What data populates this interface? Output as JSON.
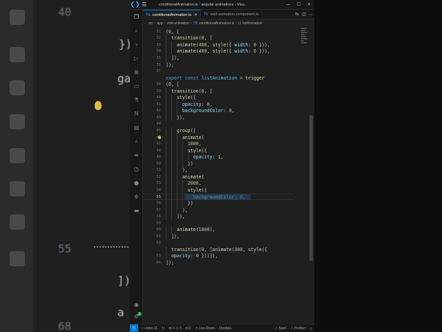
{
  "background": {
    "left_numbers": [
      "40",
      "55",
      "68"
    ],
    "left_code": [
      "});",
      "ga",
      "]),",
      "a"
    ]
  },
  "window": {
    "title": "conditionalAnimation.ts - angular-animations - Visu..."
  },
  "tabs": [
    {
      "label": "conditionalAnimation.ts",
      "active": true
    },
    {
      "label": "void-animation.component.ts",
      "active": false
    }
  ],
  "breadcrumb": [
    "src",
    "app",
    "void-animation",
    "conditionalAnimation.ts",
    "listAnimation"
  ],
  "editor": {
    "line_numbers": [
      "31",
      "32",
      "33",
      "34",
      "35",
      "36",
      "37",
      "",
      "38",
      "39",
      "40",
      "41",
      "42",
      "43",
      "44",
      "45",
      "46",
      "47",
      "48",
      "49",
      "50",
      "51",
      "52",
      "53",
      "54",
      "55",
      "56",
      "57",
      "58",
      "59",
      "60",
      "61",
      "62",
      "",
      "63",
      "64"
    ],
    "current_line": "55",
    "lines": [
      "('shrinkAnimation', [",
      "  transition('* => *', [",
      "    animate(400, style({ width: 0 })),",
      "    animate(400, style({ width: '*' })),",
      "  ]),",
      "]);",
      "",
      "export const listAnimation = trigger",
      "('listTrigger', [",
      "  transition(':enter', [",
      "    style({",
      "      opacity: 0,",
      "      backgroundColor: 'white',",
      "    }),",
      "",
      "    group([",
      "      animate(",
      "        1000,",
      "        style({",
      "          opacity: 1,",
      "        })",
      "      ),",
      "      animate(",
      "        2000,",
      "        style({",
      "          backgroundColor: 'red',",
      "        })",
      "      ),",
      "    ]),",
      "",
      "    animate(1000),",
      "  ]),",
      "",
      "  transition(':leave', [animate(300, style({",
      "  opacity: 0 }))]),",
      "]);"
    ]
  },
  "statusbar": {
    "left": [
      "video-11",
      "0",
      "0",
      "0",
      "Live Share",
      "Quokka"
    ],
    "right": [
      "Spell",
      "Prettier"
    ]
  },
  "colors": {
    "accent": "#0078d4",
    "badge": "#2ea043"
  }
}
